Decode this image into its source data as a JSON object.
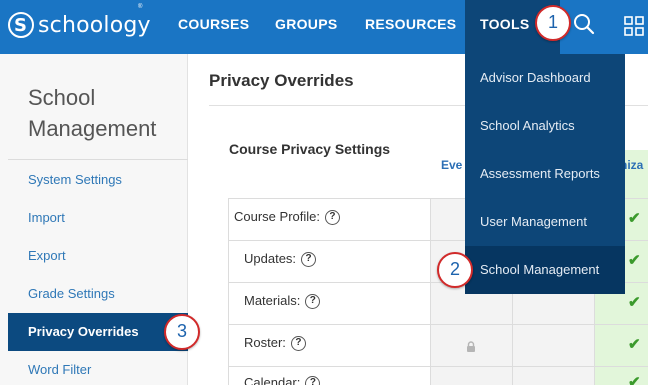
{
  "brand": {
    "name": "schoology",
    "mark": "S",
    "trademark": "®"
  },
  "nav": {
    "items": [
      {
        "label": "COURSES"
      },
      {
        "label": "GROUPS"
      },
      {
        "label": "RESOURCES"
      },
      {
        "label": "TOOLS"
      }
    ],
    "search_icon": "magnifier-icon",
    "apps_icon": "grid-icon"
  },
  "tools_menu": {
    "items": [
      {
        "label": "Advisor Dashboard"
      },
      {
        "label": "School Analytics"
      },
      {
        "label": "Assessment Reports"
      },
      {
        "label": "User Management"
      },
      {
        "label": "School Management"
      }
    ],
    "selected": "School Management"
  },
  "callouts": [
    "1",
    "2",
    "3"
  ],
  "sidebar": {
    "title": "School Management",
    "items": [
      {
        "label": "System Settings"
      },
      {
        "label": "Import"
      },
      {
        "label": "Export"
      },
      {
        "label": "Grade Settings"
      },
      {
        "label": "Privacy Overrides"
      },
      {
        "label": "Word Filter"
      }
    ],
    "active": "Privacy Overrides"
  },
  "main": {
    "page_title": "Privacy Overrides",
    "section_title": "Course Privacy Settings",
    "columns": [
      {
        "label": "Eve"
      },
      {
        "label": "niza"
      }
    ],
    "rows": [
      {
        "label": "Course Profile:"
      },
      {
        "label": "Updates:"
      },
      {
        "label": "Materials:"
      },
      {
        "label": "Roster:"
      },
      {
        "label": "Calendar:"
      }
    ],
    "help_glyph": "?"
  },
  "colors": {
    "topbar": "#1a75c4",
    "tools_active": "#0d4678",
    "sidebar_active": "#0c4a80",
    "link": "#2f78b7",
    "callout_border": "#d12a2a",
    "check": "#3b9a2c"
  }
}
